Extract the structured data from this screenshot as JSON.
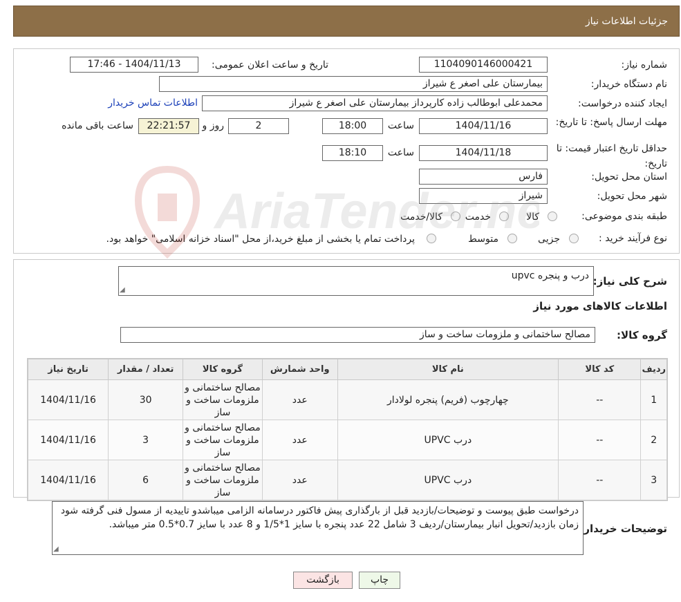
{
  "header": {
    "title": "جزئیات اطلاعات نیاز"
  },
  "fields": {
    "need_number_label": "شماره نیاز:",
    "need_number": "1104090146000421",
    "announce_label": "تاریخ و ساعت اعلان عمومی:",
    "announce_value": "1404/11/13 - 17:46",
    "buyer_org_label": "نام دستگاه خریدار:",
    "buyer_org": "بیمارستان علی اصغر  ع  شیراز",
    "requester_label": "ایجاد کننده درخواست:",
    "requester": "محمدعلی ابوطالب زاده کارپرداز بیمارستان علی اصغر  ع  شیراز",
    "contact_link": "اطلاعات تماس خریدار",
    "deadline_label": "مهلت ارسال پاسخ: تا تاریخ:",
    "deadline_date": "1404/11/16",
    "deadline_time_label": "ساعت",
    "deadline_time": "18:00",
    "days_value": "2",
    "days_label": "روز و",
    "remaining_time": "22:21:57",
    "remaining_label": "ساعت باقی مانده",
    "price_valid_label": "حداقل تاریخ اعتبار قیمت: تا تاریخ:",
    "price_valid_date": "1404/11/18",
    "price_valid_time_label": "ساعت",
    "price_valid_time": "18:10",
    "province_label": "استان محل تحویل:",
    "province": "فارس",
    "city_label": "شهر محل تحویل:",
    "city": "شیراز",
    "category_label": "طبقه بندی موضوعی:",
    "category_options": [
      "کالا",
      "خدمت",
      "کالا/خدمت"
    ],
    "process_label": "نوع فرآیند خرید :",
    "process_options": [
      "جزیی",
      "متوسط"
    ],
    "process_note": "پرداخت تمام یا بخشی از مبلغ خرید،از محل \"اسناد خزانه اسلامی\" خواهد بود."
  },
  "summary": {
    "desc_label": "شرح کلی نیاز:",
    "desc_value": "درب و پنجره upvc",
    "goods_info_title": "اطلاعات کالاهای مورد نیاز",
    "goods_group_label": "گروه کالا:",
    "goods_group_value": "مصالح ساختمانی و ملزومات ساخت و ساز"
  },
  "table": {
    "headers": [
      "ردیف",
      "کد کالا",
      "نام کالا",
      "واحد شمارش",
      "گروه کالا",
      "تعداد / مقدار",
      "تاریخ نیاز"
    ],
    "rows": [
      [
        "1",
        "--",
        "چهارچوب (فریم) پنجره لولادار",
        "عدد",
        "مصالح ساختمانی و ملزومات ساخت و ساز",
        "30",
        "1404/11/16"
      ],
      [
        "2",
        "--",
        "درب UPVC",
        "عدد",
        "مصالح ساختمانی و ملزومات ساخت و ساز",
        "3",
        "1404/11/16"
      ],
      [
        "3",
        "--",
        "درب UPVC",
        "عدد",
        "مصالح ساختمانی و ملزومات ساخت و ساز",
        "6",
        "1404/11/16"
      ]
    ]
  },
  "buyer_notes": {
    "label": "توضیحات خریدار:",
    "text": "درخواست طبق پیوست و توضیحات/بازدید قبل از بارگذاری پیش فاکتور درسامانه الزامی میباشدو تاییدیه از مسول فنی گرفته شود زمان بازدید/تحویل انبار بیمارستان/ردیف 3 شامل 22 عدد پنجره با سایز 1*1/5 و 8 عدد با سایز 0.7*0.5 متر میباشد."
  },
  "buttons": {
    "print": "چاپ",
    "back": "بازگشت"
  },
  "watermark": {
    "text": "AriaTender.neT"
  }
}
